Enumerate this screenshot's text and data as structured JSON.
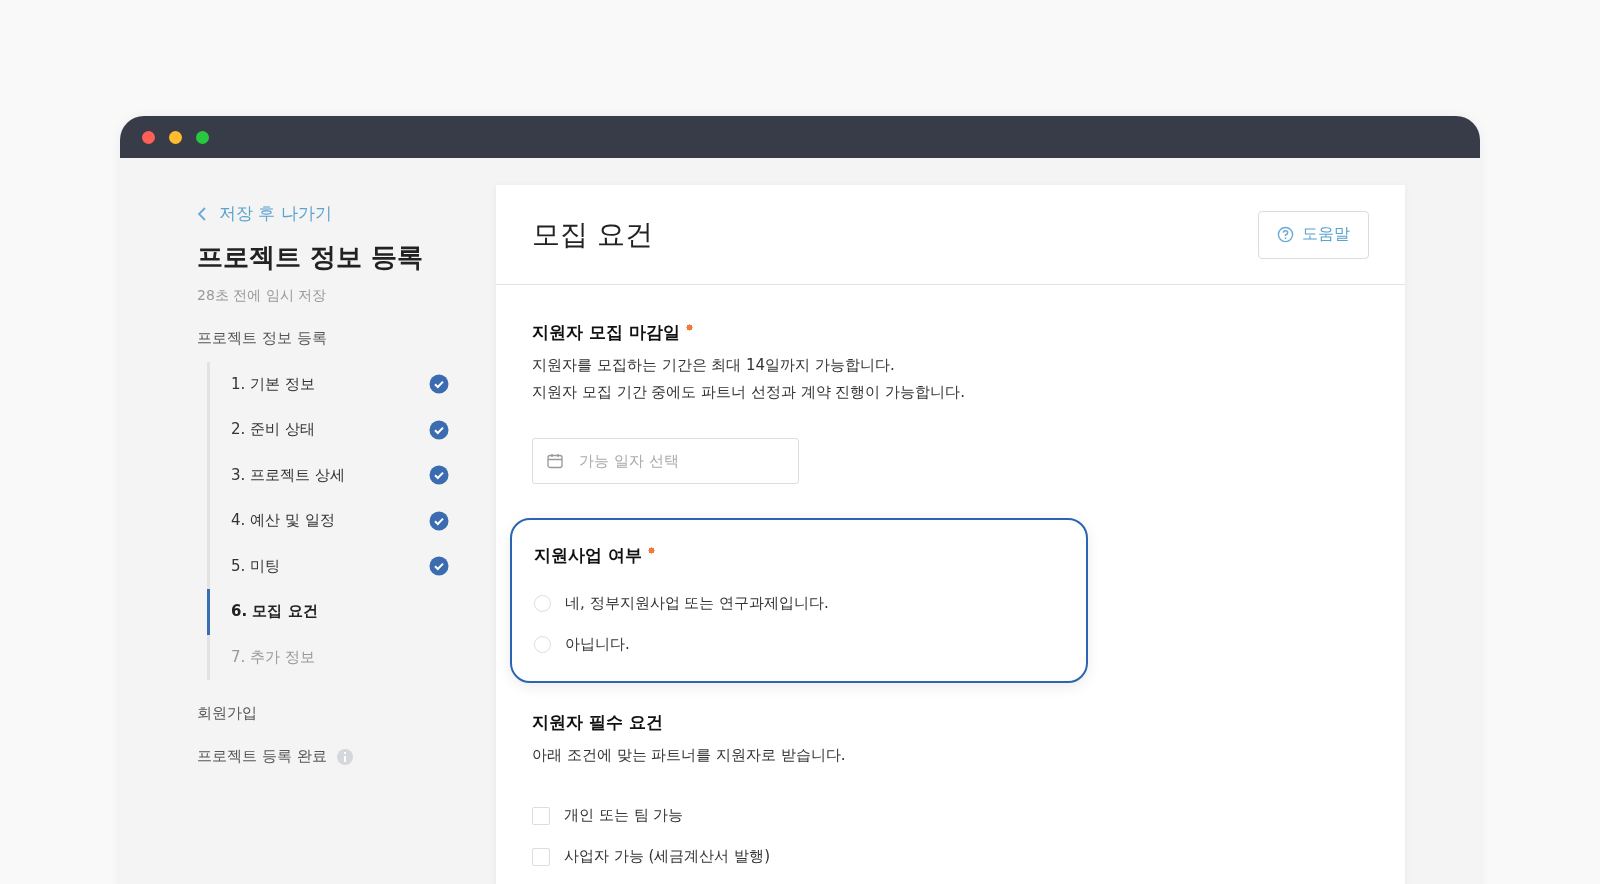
{
  "back_link": {
    "label": "저장 후 나가기"
  },
  "sidebar": {
    "title": "프로젝트 정보 등록",
    "autosave": "28초 전에 임시 저장",
    "groups": [
      {
        "label": "프로젝트 정보 등록",
        "info": false,
        "steps": [
          {
            "label": "1. 기본 정보",
            "completed": true,
            "selected": false
          },
          {
            "label": "2. 준비 상태",
            "completed": true,
            "selected": false
          },
          {
            "label": "3. 프로젝트 상세",
            "completed": true,
            "selected": false
          },
          {
            "label": "4. 예산 및 일정",
            "completed": true,
            "selected": false
          },
          {
            "label": "5. 미팅",
            "completed": true,
            "selected": false
          },
          {
            "label": "6. 모집 요건",
            "completed": false,
            "selected": true
          },
          {
            "label": "7. 추가 정보",
            "completed": false,
            "selected": false
          }
        ]
      },
      {
        "label": "회원가입",
        "info": false
      },
      {
        "label": "프로젝트 등록 완료",
        "info": true
      }
    ]
  },
  "card": {
    "title": "모집 요건",
    "help_button": "도움말",
    "sections": [
      {
        "kind": "date",
        "title": "지원자 모집 마감일",
        "required": true,
        "highlighted": false,
        "description": [
          "지원자를 모집하는 기간은 최대 14일까지 가능합니다.",
          "지원자 모집 기간 중에도 파트너 선정과 계약 진행이 가능합니다."
        ],
        "placeholder": "가능 일자 선택"
      },
      {
        "kind": "radio",
        "title": "지원사업 여부",
        "required": true,
        "highlighted": true,
        "options": [
          {
            "label": "네, 정부지원사업 또는 연구과제입니다.",
            "selected": false
          },
          {
            "label": "아닙니다.",
            "selected": false
          }
        ]
      },
      {
        "kind": "checkbox",
        "title": "지원자 필수 요건",
        "required": false,
        "highlighted": false,
        "description": [
          "아래 조건에 맞는 파트너를 지원자로 받습니다."
        ],
        "options": [
          {
            "label": "개인 또는 팀 가능",
            "checked": false
          },
          {
            "label": "사업자 가능 (세금계산서 발행)",
            "checked": false
          }
        ]
      }
    ]
  }
}
